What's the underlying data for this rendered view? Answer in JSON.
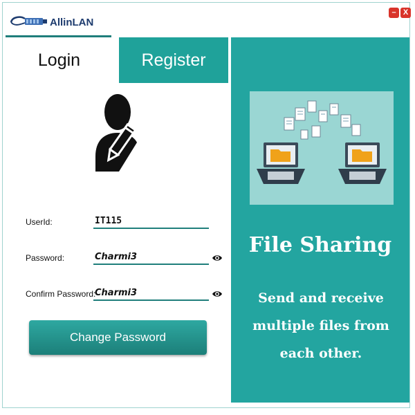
{
  "app": {
    "name": "AllinLAN",
    "minimize_symbol": "–",
    "close_symbol": "X"
  },
  "tabs": {
    "login": "Login",
    "register": "Register"
  },
  "form": {
    "userid_label": "UserId:",
    "userid_value": "IT115",
    "password_label": "Password:",
    "password_value": "Charmi3",
    "confirm_label": "Confirm Password:",
    "confirm_value": "Charmi3",
    "submit_label": "Change Password"
  },
  "promo": {
    "title": "File Sharing",
    "subtitle": "Send and receive multiple files from each other."
  },
  "icons": {
    "logo": "network-cable-icon",
    "avatar": "user-edit-icon",
    "eye": "eye-icon"
  },
  "colors": {
    "accent": "#1fa29a",
    "panel": "#23a5a0",
    "dark_accent": "#1f7e7b",
    "brand_text": "#1d3b6e",
    "window_button": "#d9342b"
  }
}
